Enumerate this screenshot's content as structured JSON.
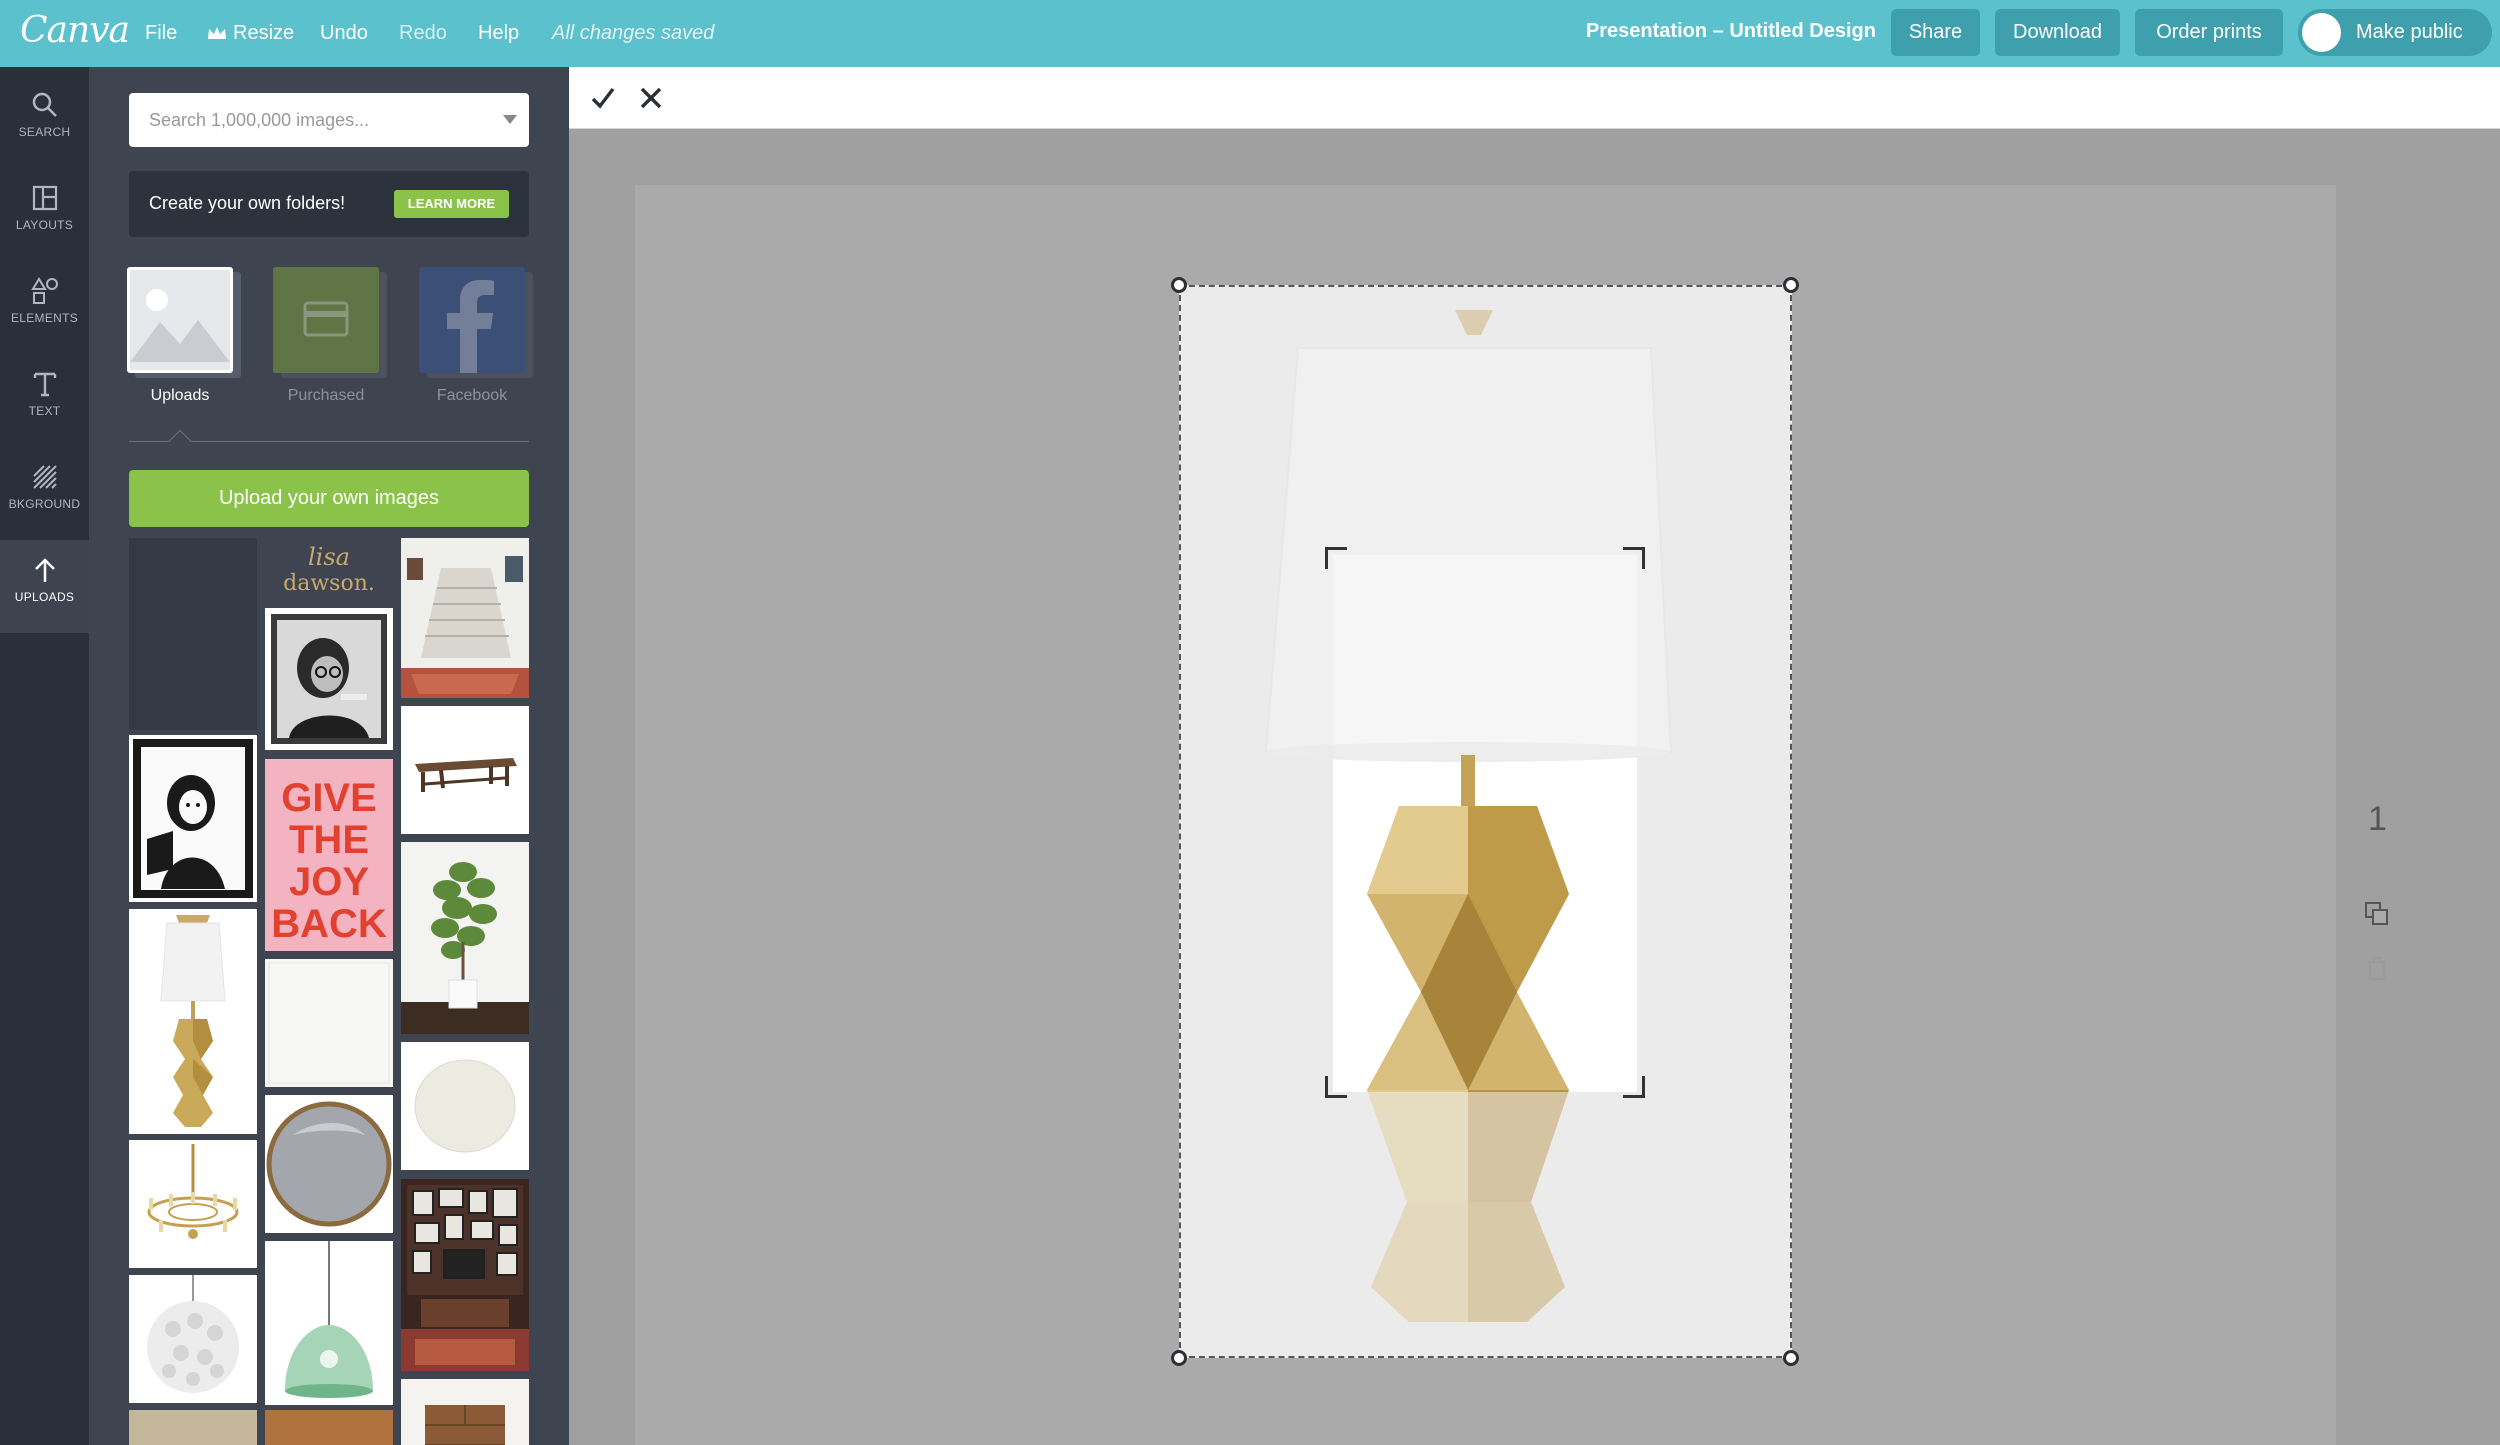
{
  "app": {
    "logo": "Canva"
  },
  "menu": {
    "file": "File",
    "resize": "Resize",
    "undo": "Undo",
    "redo": "Redo",
    "help": "Help",
    "status": "All changes saved"
  },
  "document": {
    "title": "Presentation – Untitled Design"
  },
  "actions": {
    "share": "Share",
    "download": "Download",
    "order_prints": "Order prints",
    "make_public": "Make public"
  },
  "rail": {
    "items": [
      {
        "label": "SEARCH",
        "icon": "search-icon"
      },
      {
        "label": "LAYOUTS",
        "icon": "layouts-icon"
      },
      {
        "label": "ELEMENTS",
        "icon": "elements-icon"
      },
      {
        "label": "TEXT",
        "icon": "text-icon"
      },
      {
        "label": "BKGROUND",
        "icon": "background-icon"
      },
      {
        "label": "UPLOADS",
        "icon": "upload-arrow-icon",
        "active": true
      }
    ]
  },
  "panel": {
    "search_placeholder": "Search 1,000,000 images...",
    "promo_text": "Create your own folders!",
    "learn_more": "LEARN MORE",
    "sources": [
      {
        "label": "Uploads",
        "active": true
      },
      {
        "label": "Purchased"
      },
      {
        "label": "Facebook"
      }
    ],
    "upload_button": "Upload your own images",
    "poster_text": "GIVE THE JOY BACK",
    "logo_thumb_text": "lisa dawson."
  },
  "page_indicator": {
    "number": "1"
  },
  "colors": {
    "topbar": "#5bc1cc",
    "button": "#3fa0ad",
    "accent_green": "#8bc34a",
    "rail": "#293039",
    "panel": "#3e4450",
    "canvas": "#aaaaaa"
  }
}
